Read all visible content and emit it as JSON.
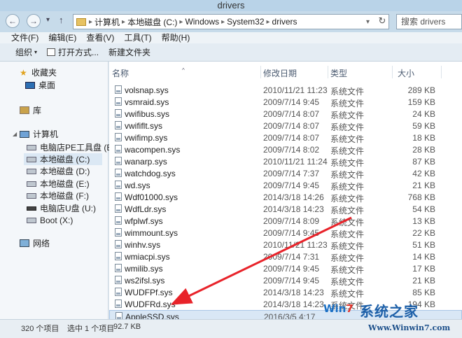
{
  "window": {
    "title": "drivers"
  },
  "nav": {
    "back": "←",
    "forward": "→",
    "dropdown": "▾",
    "up": "↑"
  },
  "address": {
    "segments": [
      "计算机",
      "本地磁盘 (C:)",
      "Windows",
      "System32",
      "drivers"
    ],
    "separator": "▸",
    "dropdown": "▾",
    "refresh": "↻"
  },
  "search": {
    "placeholder": "搜索 drivers"
  },
  "menu": [
    "文件(F)",
    "编辑(E)",
    "查看(V)",
    "工具(T)",
    "帮助(H)"
  ],
  "toolbar": {
    "organize": "组织",
    "open_with": "打开方式...",
    "new_folder": "新建文件夹",
    "caret": "▾"
  },
  "sidebar": {
    "favorites": "收藏夹",
    "desktop": "桌面",
    "libraries": "库",
    "computer": "计算机",
    "drives": [
      "电脑店PE工具盘 (B:",
      "本地磁盘 (C:)",
      "本地磁盘 (D:)",
      "本地磁盘 (E:)",
      "本地磁盘 (F:)",
      "电脑店U盘 (U:)",
      "Boot (X:)"
    ],
    "network": "网络",
    "selected_drive": 1
  },
  "columns": {
    "name": "名称",
    "date": "修改日期",
    "type": "类型",
    "size": "大小"
  },
  "files": [
    {
      "name": "volsnap.sys",
      "date": "2010/11/21 11:23",
      "type": "系统文件",
      "size": "289 KB"
    },
    {
      "name": "vsmraid.sys",
      "date": "2009/7/14 9:45",
      "type": "系统文件",
      "size": "159 KB"
    },
    {
      "name": "vwifibus.sys",
      "date": "2009/7/14 8:07",
      "type": "系统文件",
      "size": "24 KB"
    },
    {
      "name": "vwififlt.sys",
      "date": "2009/7/14 8:07",
      "type": "系统文件",
      "size": "59 KB"
    },
    {
      "name": "vwifimp.sys",
      "date": "2009/7/14 8:07",
      "type": "系统文件",
      "size": "18 KB"
    },
    {
      "name": "wacompen.sys",
      "date": "2009/7/14 8:02",
      "type": "系统文件",
      "size": "28 KB"
    },
    {
      "name": "wanarp.sys",
      "date": "2010/11/21 11:24",
      "type": "系统文件",
      "size": "87 KB"
    },
    {
      "name": "watchdog.sys",
      "date": "2009/7/14 7:37",
      "type": "系统文件",
      "size": "42 KB"
    },
    {
      "name": "wd.sys",
      "date": "2009/7/14 9:45",
      "type": "系统文件",
      "size": "21 KB"
    },
    {
      "name": "Wdf01000.sys",
      "date": "2014/3/18 14:26",
      "type": "系统文件",
      "size": "768 KB"
    },
    {
      "name": "WdfLdr.sys",
      "date": "2014/3/18 14:23",
      "type": "系统文件",
      "size": "54 KB"
    },
    {
      "name": "wfplwf.sys",
      "date": "2009/7/14 8:09",
      "type": "系统文件",
      "size": "13 KB"
    },
    {
      "name": "wimmount.sys",
      "date": "2009/7/14 9:45",
      "type": "系统文件",
      "size": "22 KB"
    },
    {
      "name": "winhv.sys",
      "date": "2010/11/21 11:23",
      "type": "系统文件",
      "size": "51 KB"
    },
    {
      "name": "wmiacpi.sys",
      "date": "2009/7/14 7:31",
      "type": "系统文件",
      "size": "14 KB"
    },
    {
      "name": "wmilib.sys",
      "date": "2009/7/14 9:45",
      "type": "系统文件",
      "size": "17 KB"
    },
    {
      "name": "ws2ifsl.sys",
      "date": "2009/7/14 9:45",
      "type": "系统文件",
      "size": "21 KB"
    },
    {
      "name": "WUDFPf.sys",
      "date": "2014/3/18 14:23",
      "type": "系统文件",
      "size": "85 KB"
    },
    {
      "name": "WUDFRd.sys",
      "date": "2014/3/18 14:23",
      "type": "系统文件",
      "size": "194 KB"
    },
    {
      "name": "AppleSSD.sys",
      "date": "2016/3/5 4:17",
      "type": "",
      "size": ""
    }
  ],
  "selected_file": 19,
  "status": {
    "count": "320 个项目",
    "selection": "选中 1 个项目",
    "size": "92.7 KB"
  },
  "watermark": {
    "logo_a": "Win",
    "logo_b": "7",
    "name": "系统之家",
    "url": "Www.Winwin7.com"
  },
  "colors": {
    "arrow": "#e8232a",
    "selection": "#d9e7f5"
  }
}
